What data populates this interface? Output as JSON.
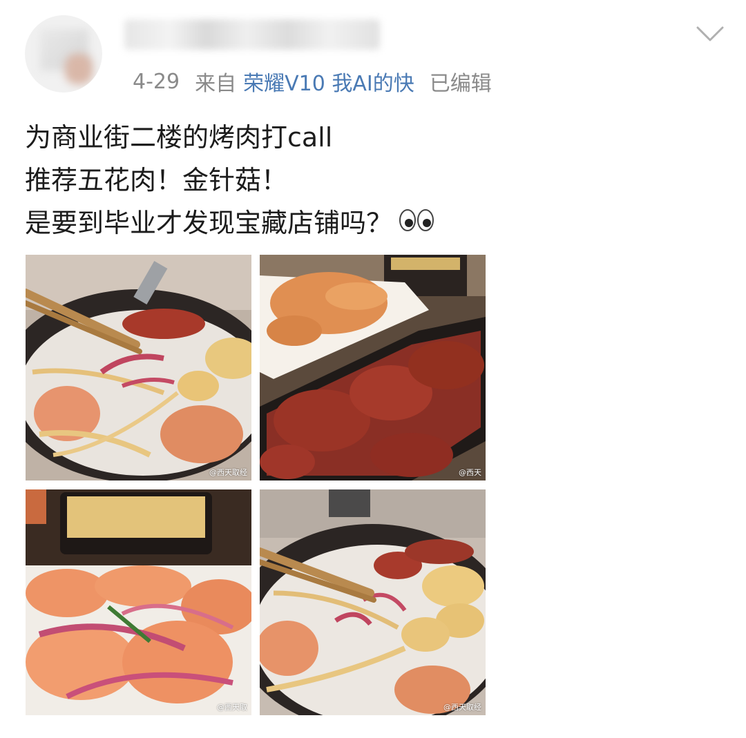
{
  "post": {
    "date": "4-29",
    "from_label": "来自",
    "device": "荣耀V10 我AI的快",
    "edited_label": "已编辑",
    "text_lines": [
      "为商业街二楼的烤肉打call",
      "推荐五花肉！金针菇！",
      "是要到毕业才发现宝藏店铺吗？"
    ],
    "emoji": "eyes-emoji"
  },
  "photos": [
    {
      "name": "grill-pork-enoki",
      "watermark": "@西天取经"
    },
    {
      "name": "marinated-beef-platter",
      "watermark": "@西天"
    },
    {
      "name": "pork-belly-onion",
      "watermark": "@西天取"
    },
    {
      "name": "grill-mixed-enoki",
      "watermark": "@西天取经"
    }
  ],
  "icons": {
    "menu": "chevron-down-icon"
  },
  "colors": {
    "meta_gray": "#8a8a8a",
    "device_link": "#4a7ab4",
    "text": "#1c1c1c"
  }
}
